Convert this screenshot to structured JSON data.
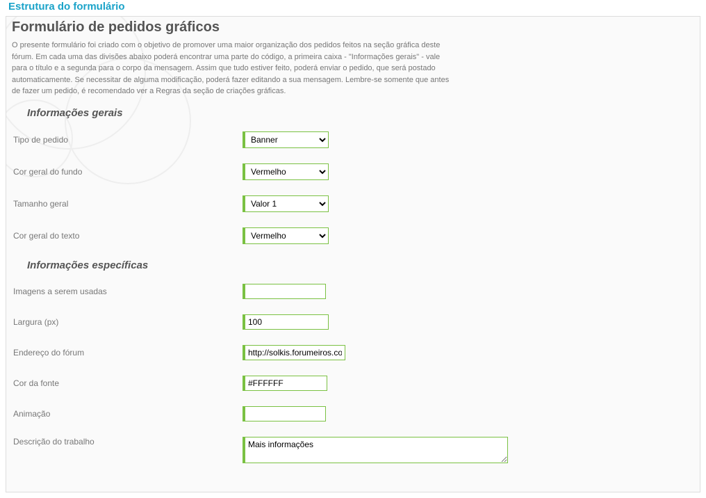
{
  "section_title": "Estrutura do formulário",
  "form_title": "Formulário de pedidos gráficos",
  "form_desc": "O presente formulário foi criado com o objetivo de promover uma maior organização dos pedidos feitos na seção gráfica deste fórum. Em cada uma das divisões abaixo poderá encontrar uma parte do código, a primeira caixa - \"Informações gerais\" - vale para o título e a segunda para o corpo da mensagem. Assim que tudo estiver feito, poderá enviar o pedido, que será postado automaticamente. Se necessitar de alguma modificação, poderá fazer editando a sua mensagem. Lembre-se somente que antes de fazer um pedido, é recomendado ver a Regras da seção de criações gráficas.",
  "groups": {
    "general_title": "Informações gerais",
    "specific_title": "Informações específicas"
  },
  "fields": {
    "tipo_pedido": {
      "label": "Tipo de pedido",
      "value": "Banner"
    },
    "cor_fundo": {
      "label": "Cor geral do fundo",
      "value": "Vermelho"
    },
    "tamanho": {
      "label": "Tamanho geral",
      "value": "Valor 1"
    },
    "cor_texto": {
      "label": "Cor geral do texto",
      "value": "Vermelho"
    },
    "imagens": {
      "label": "Imagens a serem usadas",
      "value": ""
    },
    "largura": {
      "label": "Largura (px)",
      "value": "100"
    },
    "endereco": {
      "label": "Endereço do fórum",
      "value": "http://solkis.forumeiros.com"
    },
    "cor_fonte": {
      "label": "Cor da fonte",
      "value": "#FFFFFF"
    },
    "animacao": {
      "label": "Animação",
      "value": ""
    },
    "descricao": {
      "label": "Descrição do trabalho",
      "value": "Mais informações"
    }
  },
  "select_options": {
    "tipo_pedido": [
      "Banner"
    ],
    "cor_fundo": [
      "Vermelho"
    ],
    "tamanho": [
      "Valor 1"
    ],
    "cor_texto": [
      "Vermelho"
    ]
  }
}
